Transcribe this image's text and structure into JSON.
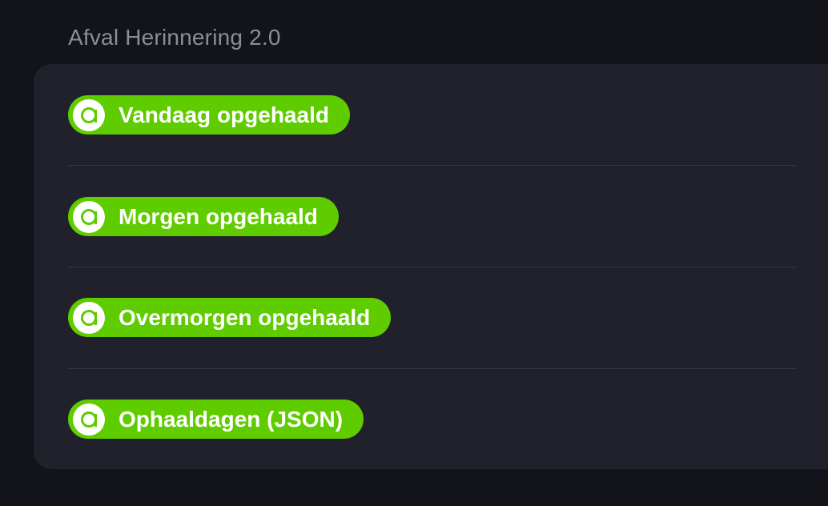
{
  "section": {
    "title": "Afval Herinnering 2.0"
  },
  "theme": {
    "background": "#131419",
    "card": "#20212b",
    "pill": "#5fcc00",
    "title_color": "#8b8d98"
  },
  "items": [
    {
      "label": "Vandaag opgehaald",
      "icon": "letter-a-icon"
    },
    {
      "label": "Morgen opgehaald",
      "icon": "letter-a-icon"
    },
    {
      "label": "Overmorgen opgehaald",
      "icon": "letter-a-icon"
    },
    {
      "label": "Ophaaldagen (JSON)",
      "icon": "letter-a-icon"
    }
  ]
}
